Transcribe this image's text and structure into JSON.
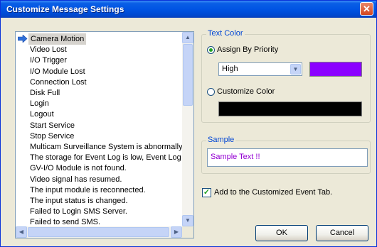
{
  "window": {
    "title": "Customize Message Settings"
  },
  "event_list": {
    "items": [
      "Camera Motion",
      "Video Lost",
      "I/O Trigger",
      "I/O Module Lost",
      "Connection Lost",
      "Disk Full",
      "Login",
      "Logout",
      "Start Service",
      "Stop Service",
      "Multicam Surveillance System is abnormally c",
      "The storage for Event Log is low, Event Log w",
      "GV-I/O Module is not found.",
      "Video signal has resumed.",
      "The input module is reconnected.",
      "The input status is changed.",
      "Failed to Login SMS Server.",
      "Failed to send SMS."
    ],
    "selected_index": 0
  },
  "text_color": {
    "legend": "Text Color",
    "assign_by_priority_label": "Assign By Priority",
    "assign_by_priority_selected": true,
    "priority_value": "High",
    "priority_color": "#8b00ff",
    "customize_color_label": "Customize Color",
    "customize_color_selected": false,
    "custom_color": "#000000"
  },
  "sample": {
    "legend": "Sample",
    "text": "Sample Text !!",
    "text_color": "#9400d3"
  },
  "add_to_tab": {
    "label": "Add to the Customized Event Tab.",
    "checked": true
  },
  "buttons": {
    "ok": "OK",
    "cancel": "Cancel"
  },
  "icons": {
    "selected_item": "arrow-right-icon",
    "close": "close-icon"
  }
}
